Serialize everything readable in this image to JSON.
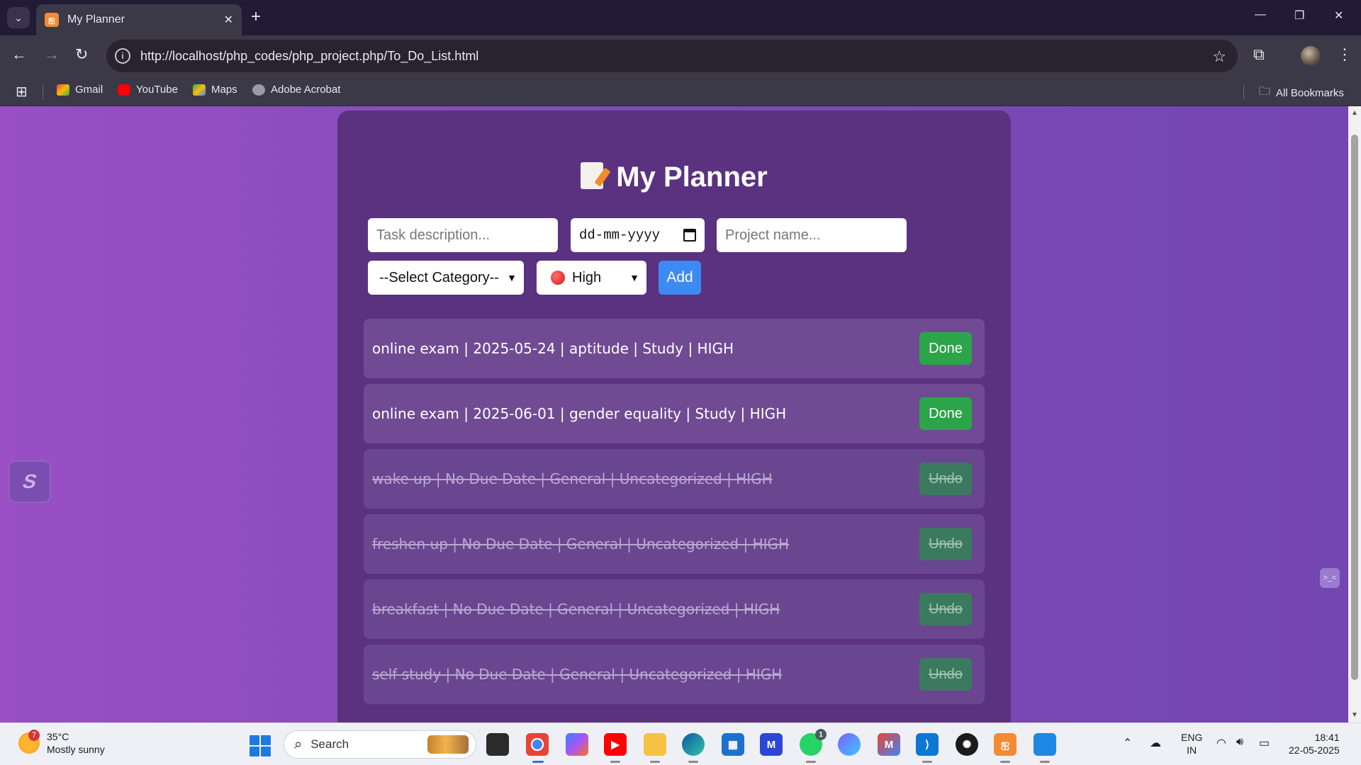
{
  "browser": {
    "tab_title": "My Planner",
    "url": "http://localhost/php_codes/php_project.php/To_Do_List.html",
    "bookmarks": [
      "Gmail",
      "YouTube",
      "Maps",
      "Adobe Acrobat"
    ],
    "all_bookmarks": "All Bookmarks"
  },
  "planner": {
    "title": "My Planner",
    "task_placeholder": "Task description...",
    "date_placeholder": "dd-mm-yyyy",
    "project_placeholder": "Project name...",
    "category_selected": "--Select Category--",
    "priority_selected": "High",
    "add_label": "Add",
    "tasks": [
      {
        "text": "online exam | 2025-05-24 | aptitude | Study | HIGH",
        "button": "Done",
        "completed": false
      },
      {
        "text": "online exam | 2025-06-01 | gender equality | Study | HIGH",
        "button": "Done",
        "completed": false
      },
      {
        "text": "wake up | No Due Date | General | Uncategorized | HIGH",
        "button": "Undo",
        "completed": true
      },
      {
        "text": "freshen up | No Due Date | General | Uncategorized | HIGH",
        "button": "Undo",
        "completed": true
      },
      {
        "text": "breakfast | No Due Date | General | Uncategorized | HIGH",
        "button": "Undo",
        "completed": true
      },
      {
        "text": "self study | No Due Date | General | Uncategorized | HIGH",
        "button": "Undo",
        "completed": true
      }
    ]
  },
  "taskbar": {
    "temperature": "35°C",
    "weather": "Mostly sunny",
    "weather_badge": "7",
    "search": "Search",
    "whatsapp_badge": "1",
    "lang_top": "ENG",
    "lang_bottom": "IN",
    "time": "18:41",
    "date": "22-05-2025"
  },
  "colors": {
    "page_gradient_left": "#9a4fc4",
    "page_gradient_right": "#7446b2",
    "card": "#5a3280",
    "add_button": "#3d8af2",
    "done_button": "#2ca44a",
    "undo_button": "#3c7a5f"
  }
}
